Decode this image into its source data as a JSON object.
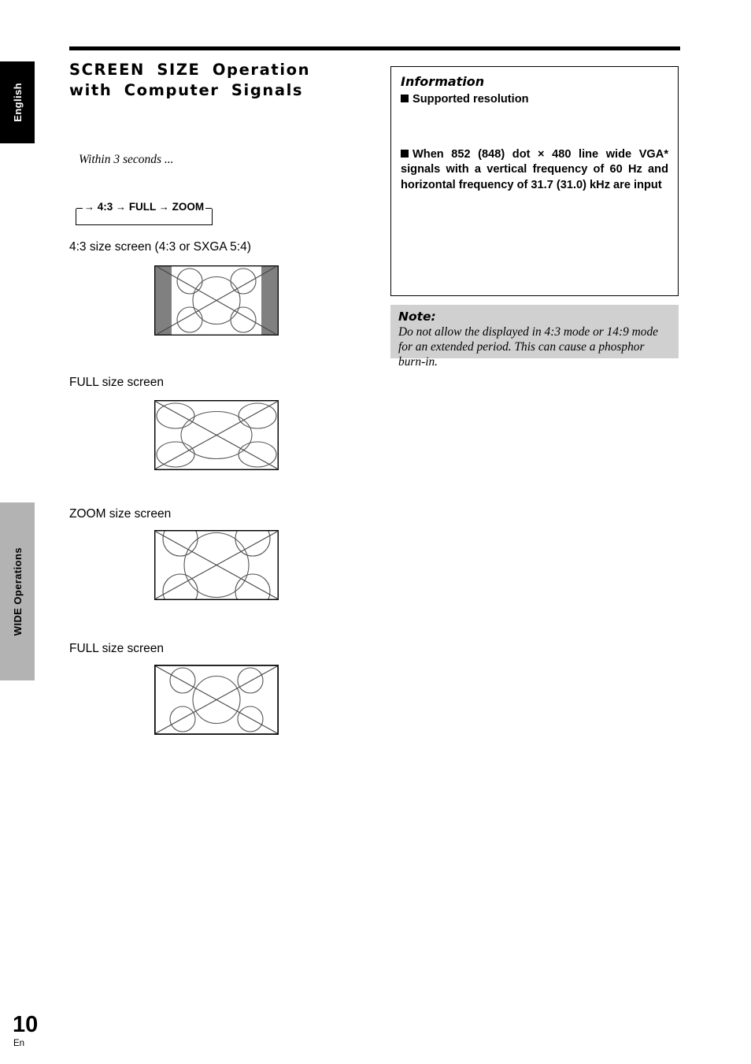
{
  "tabs": {
    "language": "English",
    "section": "WIDE Operations"
  },
  "header": {
    "title": "SCREEN SIZE Operation with Computer Signals"
  },
  "left": {
    "within_text": "Within 3 seconds ...",
    "cycle": {
      "arrow": "→",
      "modes": [
        "4:3",
        "FULL",
        "ZOOM"
      ]
    },
    "screens": [
      {
        "label": "4:3 size screen (4:3 or SXGA 5:4)",
        "mode": "4:3"
      },
      {
        "label": "FULL size screen",
        "mode": "FULL"
      },
      {
        "label": "ZOOM size screen",
        "mode": "ZOOM"
      },
      {
        "label": "FULL size screen",
        "mode": "FULL2"
      }
    ]
  },
  "information": {
    "heading": "Information",
    "items": [
      "Supported resolution",
      "When 852 (848) dot × 480 line wide VGA* signals with a vertical frequency of 60 Hz and horizontal frequency of 31.7 (31.0) kHz are input"
    ]
  },
  "note": {
    "heading": "Note:",
    "body": "Do not allow the displayed in 4:3 mode or 14:9 mode for an extended period. This can cause a phosphor burn-in."
  },
  "footer": {
    "page_number": "10",
    "language_code": "En"
  },
  "colors": {
    "sidebar_gray": "#b3b3b3",
    "note_gray": "#d0d0d0",
    "pillarbox_gray": "#808080",
    "ink": "#000000"
  }
}
